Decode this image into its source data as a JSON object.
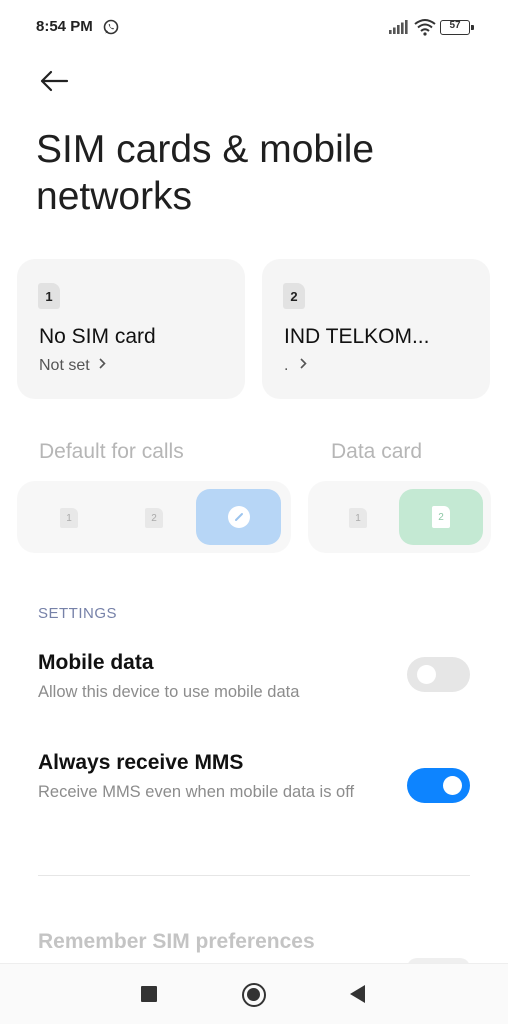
{
  "status_bar": {
    "time": "8:54 PM",
    "notification_icon": "whatsapp-icon",
    "battery_level": "57",
    "icons": [
      "signal-icon",
      "wifi-icon",
      "battery-icon"
    ]
  },
  "header": {
    "back_icon": "arrow-left-icon",
    "title": "SIM cards & mobile networks"
  },
  "sim_cards": [
    {
      "slot": "1",
      "name": "No SIM card",
      "status": "Not set"
    },
    {
      "slot": "2",
      "name": "IND TELKOM...",
      "status": "."
    }
  ],
  "defaults": {
    "calls_label": "Default for calls",
    "data_label": "Data card",
    "calls_options": [
      "1",
      "2"
    ],
    "calls_selected_icon": "pencil-icon",
    "data_options": [
      "1",
      "2"
    ],
    "data_selected": "2",
    "colors": {
      "calls_selected": "#b7d6f6",
      "data_selected": "#c4e9d3"
    }
  },
  "settings": {
    "header": "SETTINGS",
    "mobile_data": {
      "title": "Mobile data",
      "subtitle": "Allow this device to use mobile data",
      "enabled": false
    },
    "always_mms": {
      "title": "Always receive MMS",
      "subtitle": "Receive MMS even when mobile data is off",
      "enabled": true
    },
    "remember_sim": {
      "title": "Remember SIM preferences"
    },
    "colors": {
      "toggle_on": "#0d84ff",
      "toggle_off": "#e6e6e6"
    }
  },
  "nav_bar": {
    "icons": [
      "recents-square-icon",
      "home-circle-icon",
      "back-triangle-icon"
    ]
  }
}
